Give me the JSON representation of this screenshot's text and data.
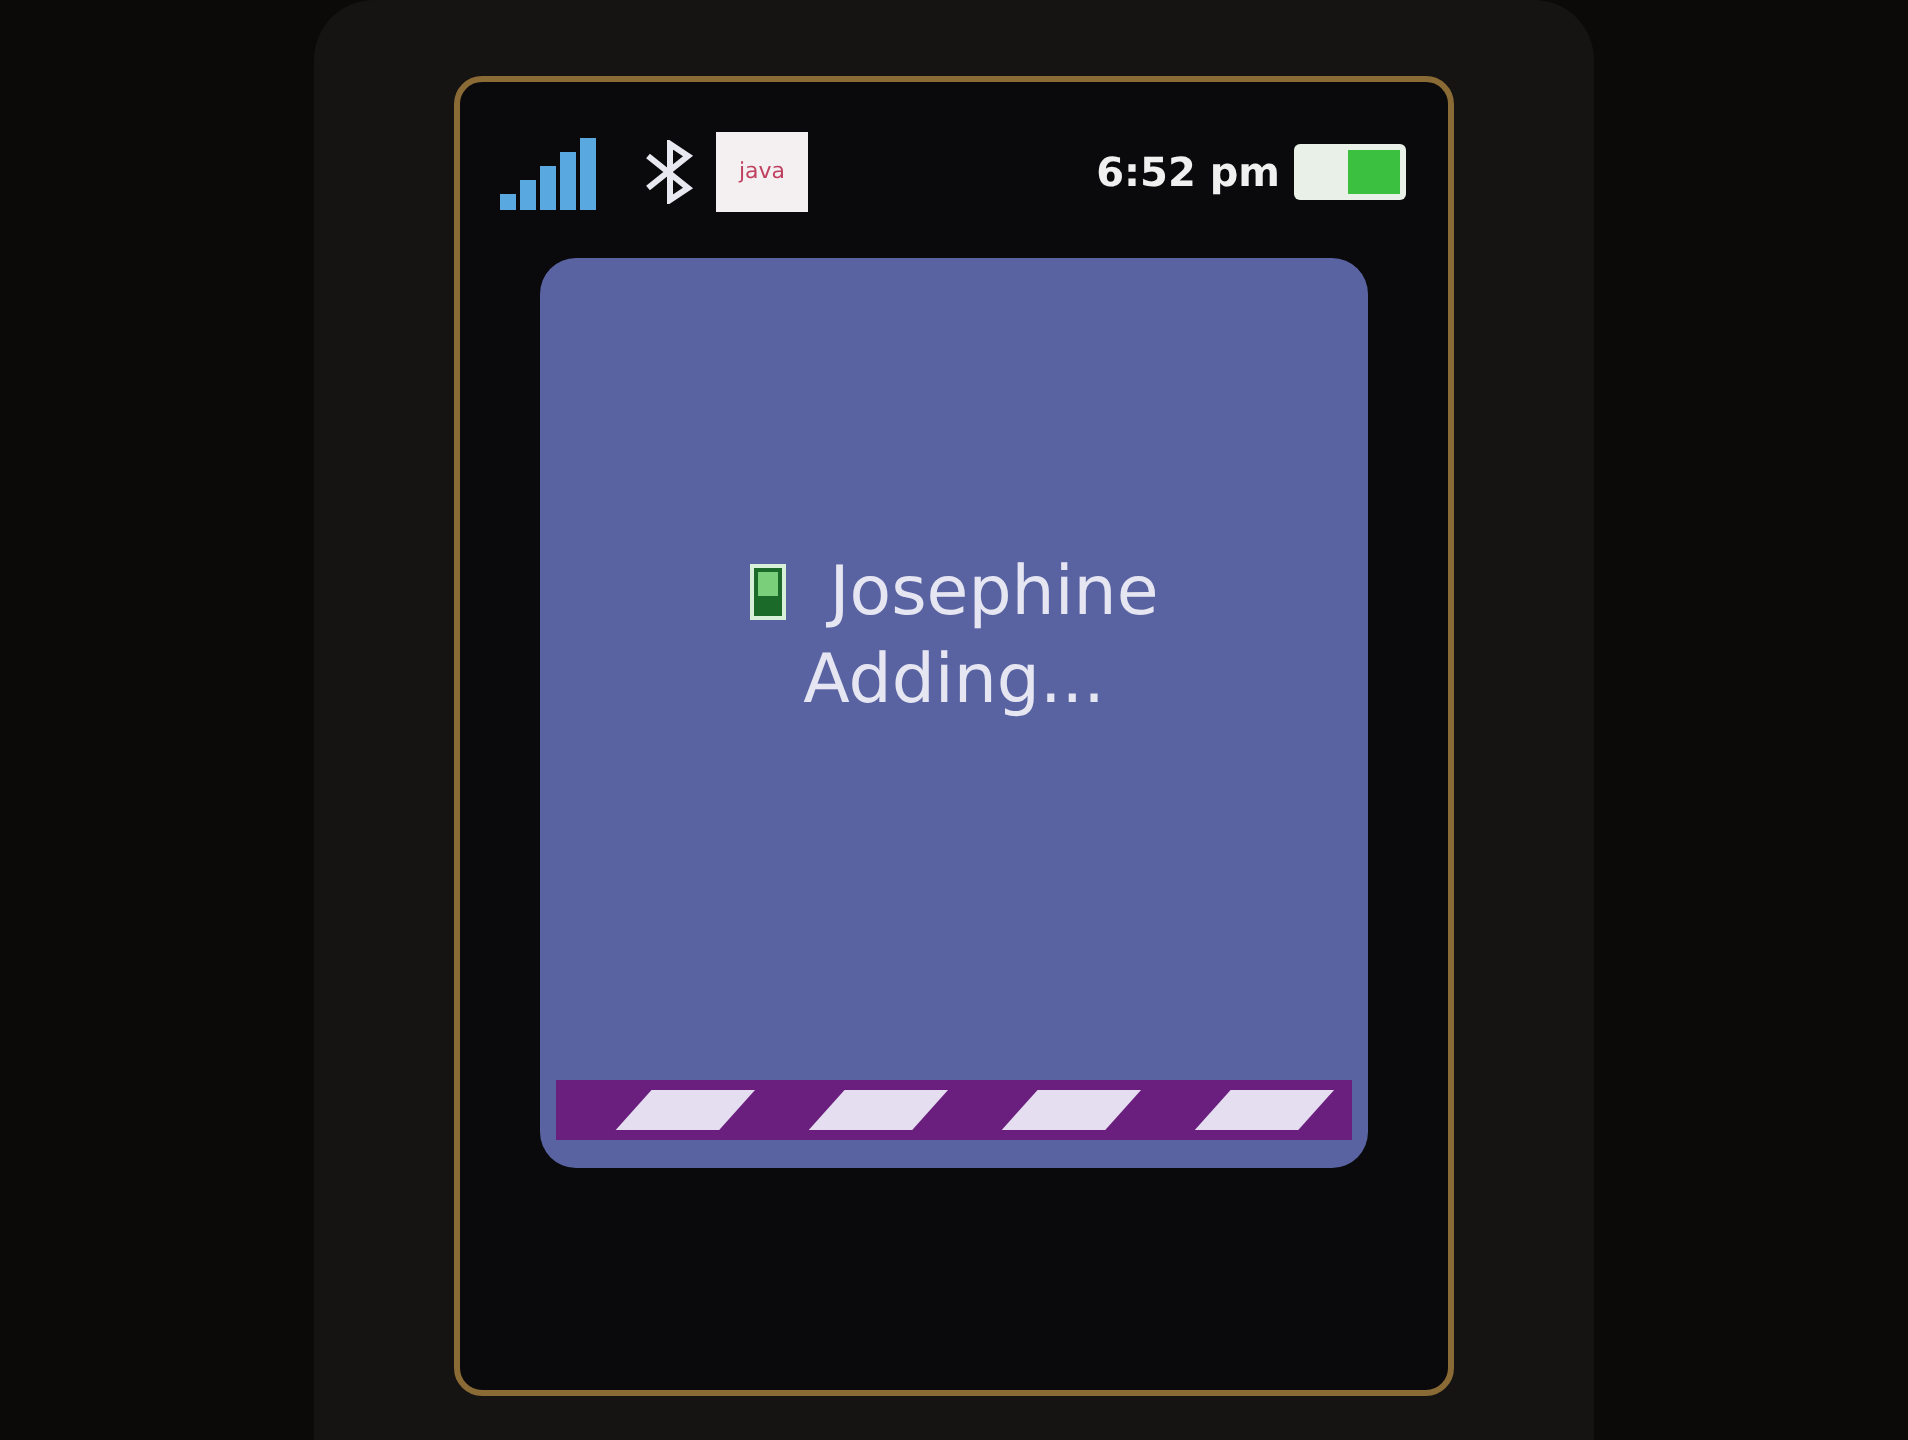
{
  "status_bar": {
    "java_icon": {
      "label": "java"
    },
    "time": "6:52 pm"
  },
  "dialog": {
    "contact": "Josephine",
    "status": "Adding...",
    "progress_bar": {
      "kind": "indeterminate"
    }
  }
}
